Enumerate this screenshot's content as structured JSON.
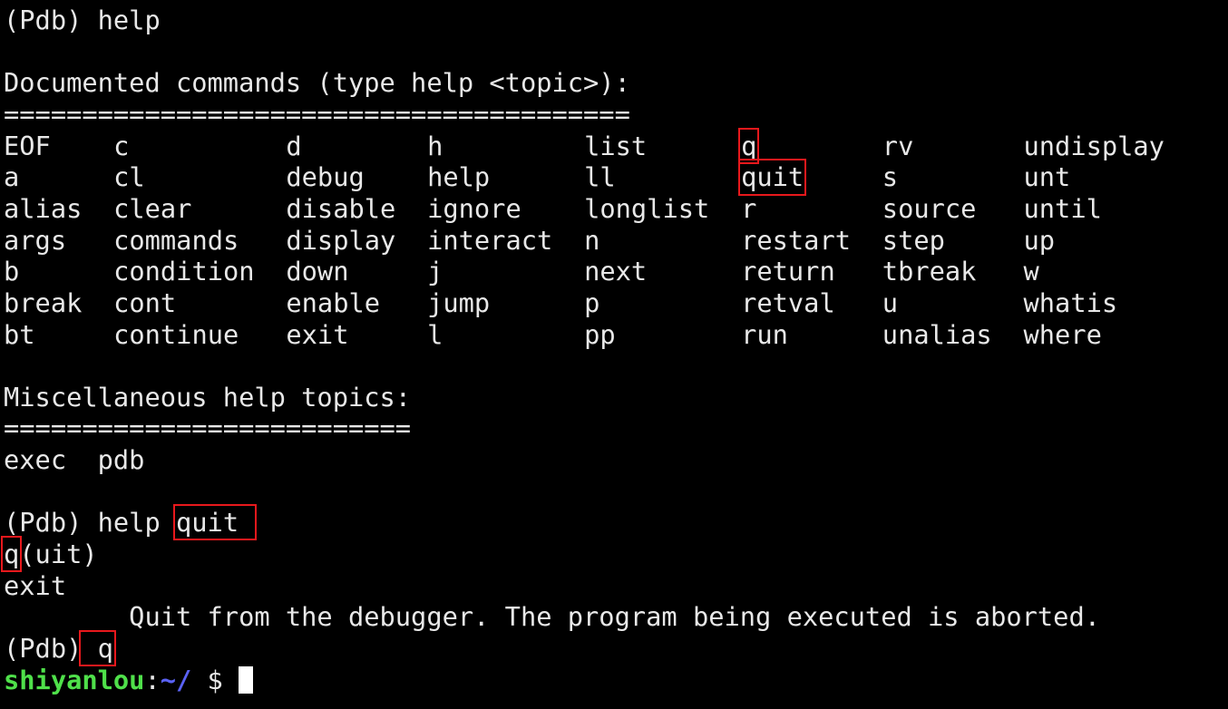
{
  "terminal": {
    "prompt_help": "(Pdb) help",
    "documented_heading": "Documented commands (type help <topic>):",
    "documented_rule": "========================================",
    "commands_table": [
      [
        "EOF",
        "c",
        "d",
        "h",
        "list",
        "q",
        "rv",
        "undisplay"
      ],
      [
        "a",
        "cl",
        "debug",
        "help",
        "ll",
        "quit",
        "s",
        "unt"
      ],
      [
        "alias",
        "clear",
        "disable",
        "ignore",
        "longlist",
        "r",
        "source",
        "until"
      ],
      [
        "args",
        "commands",
        "display",
        "interact",
        "n",
        "restart",
        "step",
        "up"
      ],
      [
        "b",
        "condition",
        "down",
        "j",
        "next",
        "return",
        "tbreak",
        "w"
      ],
      [
        "break",
        "cont",
        "enable",
        "jump",
        "p",
        "retval",
        "u",
        "whatis"
      ],
      [
        "bt",
        "continue",
        "exit",
        "l",
        "pp",
        "run",
        "unalias",
        "where"
      ]
    ],
    "highlighted_cells": [
      "0-5",
      "1-5"
    ],
    "misc_heading": "Miscellaneous help topics:",
    "misc_rule": "==========================",
    "misc_topics": "exec  pdb",
    "prompt_help_quit_prefix": "(Pdb) help ",
    "prompt_help_quit_arg": "quit ",
    "quit_usage_q": "q",
    "quit_usage_rest": "(uit)",
    "exit_line": "exit",
    "quit_description": "        Quit from the debugger. The program being executed is aborted.",
    "prompt_q_prefix": "(Pdb)",
    "prompt_q_arg": " q",
    "shell_user": "shiyanlou",
    "shell_colon": ":",
    "shell_path": "~/",
    "shell_symbol": " $ ",
    "highlight_color": "#e8181c",
    "user_color": "#4fe04a",
    "path_color": "#5a62f5"
  }
}
